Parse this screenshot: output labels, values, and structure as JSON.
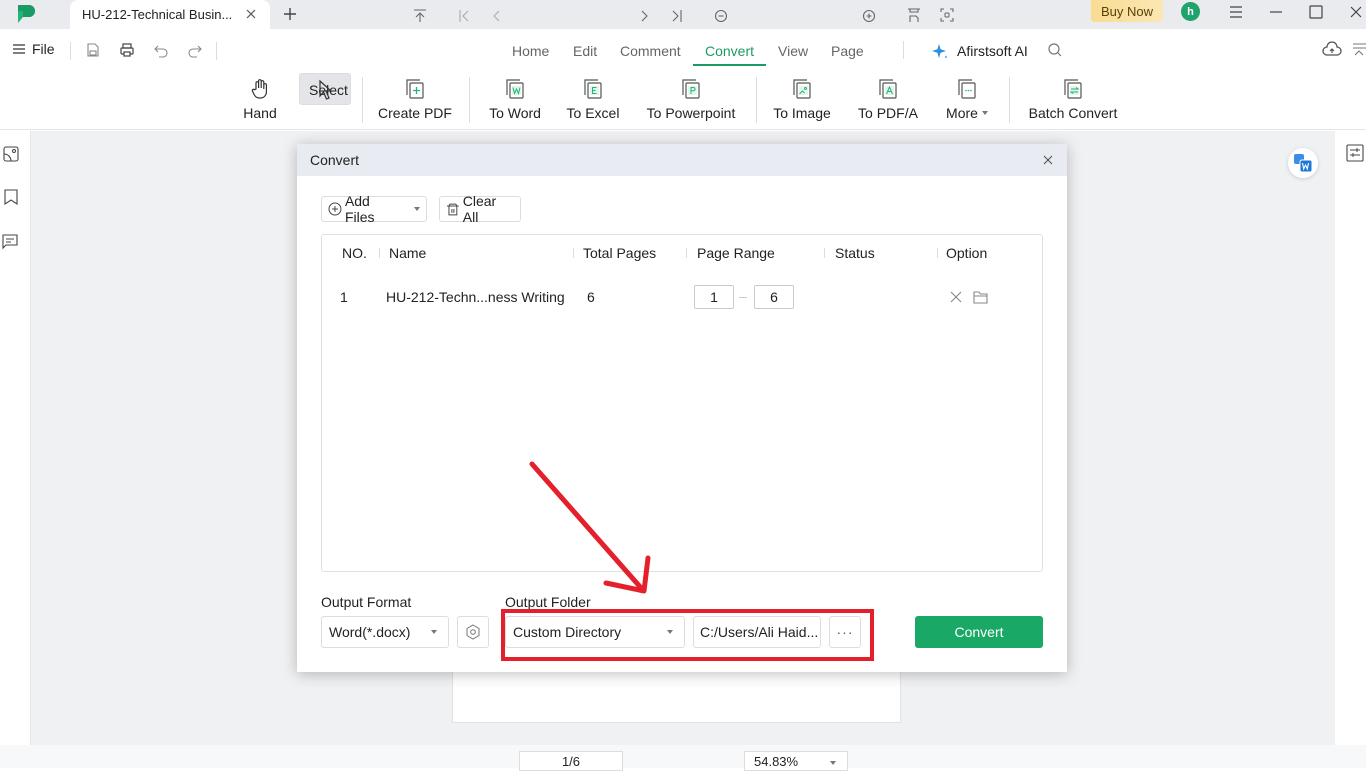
{
  "titlebar": {
    "tab_title": "HU-212-Technical Busin...",
    "buy_now": "Buy Now",
    "avatar_initial": "h"
  },
  "menubar": {
    "file_label": "File",
    "nav_tabs": [
      {
        "label": "Home",
        "active": false
      },
      {
        "label": "Edit",
        "active": false
      },
      {
        "label": "Comment",
        "active": false
      },
      {
        "label": "Convert",
        "active": true
      },
      {
        "label": "View",
        "active": false
      },
      {
        "label": "Page",
        "active": false
      }
    ],
    "ai_label": "Afirstsoft AI"
  },
  "ribbon": {
    "items": [
      {
        "label": "Hand",
        "icon": "hand-icon"
      },
      {
        "label": "Select",
        "icon": "cursor-icon",
        "selected": true
      },
      {
        "label": "Create PDF",
        "icon": "create-pdf-icon"
      },
      {
        "label": "To Word",
        "icon": "to-word-icon"
      },
      {
        "label": "To Excel",
        "icon": "to-excel-icon"
      },
      {
        "label": "To Powerpoint",
        "icon": "to-powerpoint-icon"
      },
      {
        "label": "To Image",
        "icon": "to-image-icon"
      },
      {
        "label": "To PDF/A",
        "icon": "to-pdfa-icon"
      },
      {
        "label": "More",
        "icon": "more-icon"
      },
      {
        "label": "Batch Convert",
        "icon": "batch-convert-icon"
      }
    ]
  },
  "dialog": {
    "title": "Convert",
    "add_files": "Add Files",
    "clear_all": "Clear All",
    "columns": [
      "NO.",
      "Name",
      "Total Pages",
      "Page Range",
      "Status",
      "Option"
    ],
    "rows": [
      {
        "no": "1",
        "name": "HU-212-Techn...ness Writing",
        "total_pages": "6",
        "range_from": "1",
        "range_to": "6",
        "status": ""
      }
    ],
    "output_format_label": "Output Format",
    "output_format_value": "Word(*.docx)",
    "output_folder_label": "Output Folder",
    "output_folder_value": "Custom Directory",
    "output_path": "C:/Users/Ali Haid...",
    "browse_label": "···",
    "convert_label": "Convert"
  },
  "bottombar": {
    "page_indicator": "1/6",
    "zoom_level": "54.83%"
  },
  "colors": {
    "accent": "#1aa867",
    "annotation_red": "#e3202b",
    "buy_now_bg": "#f9dc92"
  }
}
